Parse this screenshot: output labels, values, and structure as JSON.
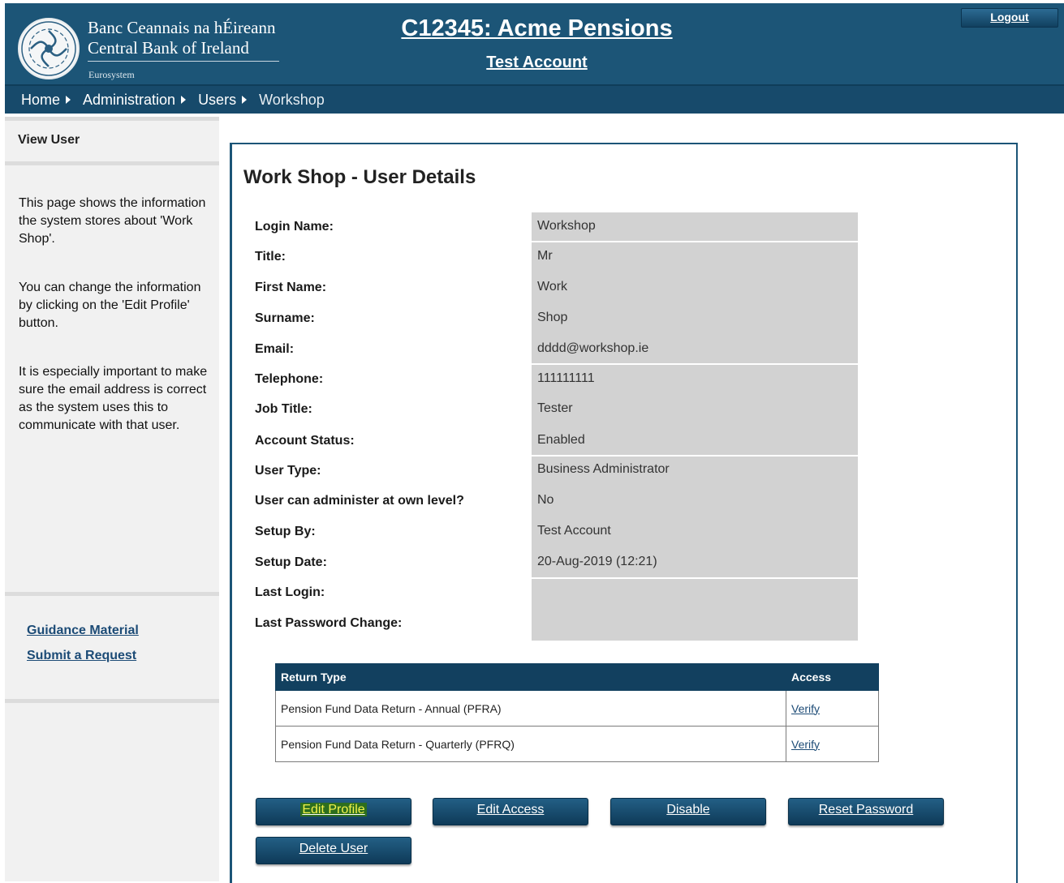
{
  "header": {
    "brand_irish": "Banc Ceannais na hÉireann",
    "brand_english": "Central Bank of Ireland",
    "brand_sub": "Eurosystem",
    "org_title": "C12345: Acme Pensions",
    "account_title": "Test Account",
    "logout_label": "Logout"
  },
  "breadcrumb": [
    "Home",
    "Administration",
    "Users",
    "Workshop"
  ],
  "sidebar": {
    "heading": "View User",
    "para1": "This page shows the information the system stores about 'Work Shop'.",
    "para2": "You can change the information by clicking on the 'Edit Profile' button.",
    "para3": "It is especially important to make sure the email address is correct as the system uses this to communicate with that user.",
    "links": [
      "Guidance Material",
      "Submit a Request"
    ]
  },
  "main": {
    "title": "Work Shop - User Details",
    "fields": [
      {
        "label": "Login Name:",
        "value": "Workshop"
      },
      {
        "label": "Title:",
        "value": "Mr"
      },
      {
        "label": "First Name:",
        "value": "Work"
      },
      {
        "label": "Surname:",
        "value": "Shop"
      },
      {
        "label": "Email:",
        "value": "dddd@workshop.ie"
      },
      {
        "label": "Telephone:",
        "value": "111111111"
      },
      {
        "label": "Job Title:",
        "value": "Tester"
      },
      {
        "label": "Account Status:",
        "value": "Enabled"
      },
      {
        "label": "User Type:",
        "value": "Business Administrator"
      },
      {
        "label": "User can administer at own level?",
        "value": "No"
      },
      {
        "label": "Setup By:",
        "value": "Test Account"
      },
      {
        "label": "Setup Date:",
        "value": "20-Aug-2019 (12:21)"
      },
      {
        "label": "Last Login:",
        "value": ""
      },
      {
        "label": "Last Password Change:",
        "value": ""
      }
    ],
    "table": {
      "headers": [
        "Return Type",
        "Access"
      ],
      "rows": [
        {
          "return_type": "Pension Fund Data Return - Annual (PFRA)",
          "access": "Verify"
        },
        {
          "return_type": "Pension Fund Data Return - Quarterly (PFRQ)",
          "access": "Verify"
        }
      ]
    },
    "buttons": {
      "edit_profile": "Edit Profile",
      "edit_access": "Edit Access",
      "disable": "Disable",
      "reset_password": "Reset Password",
      "delete_user": "Delete User"
    }
  },
  "colors": {
    "header_bg": "#1c5577",
    "crumb_bg": "#174a6b",
    "table_header_bg": "#12405f",
    "value_box_bg": "#d2d2d2",
    "highlight": "#f2f24a"
  }
}
